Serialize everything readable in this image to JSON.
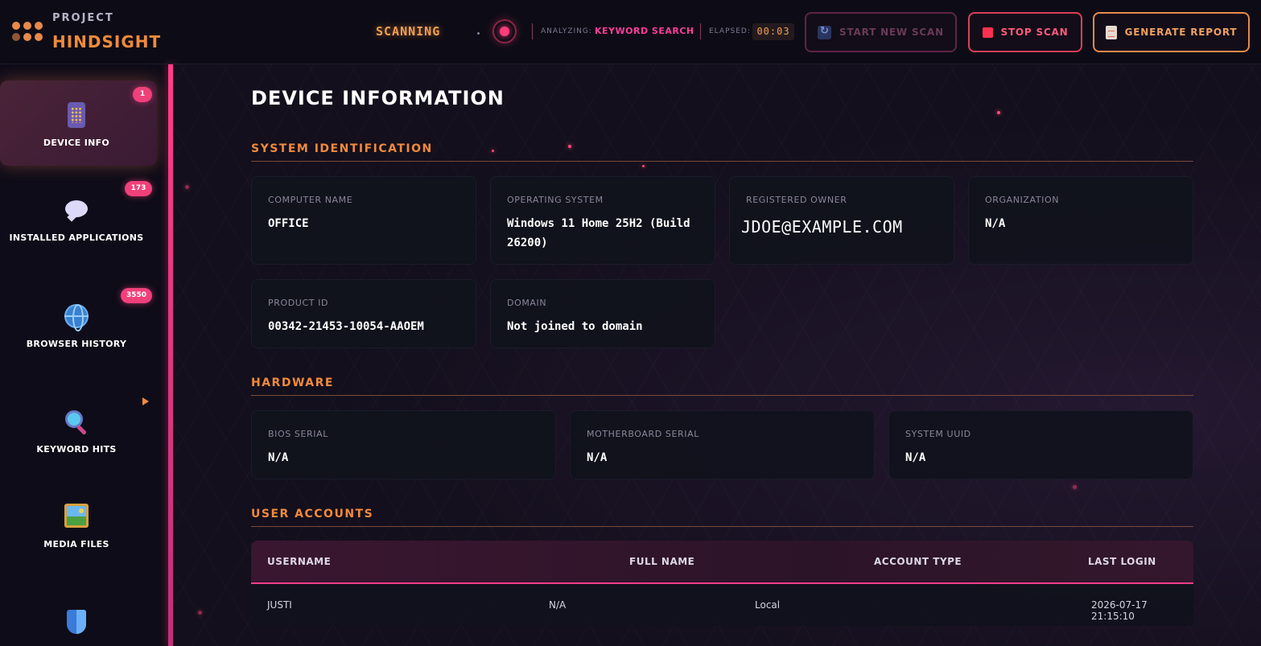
{
  "app": {
    "brand_top": "PROJECT",
    "brand_main": "HINDSIGHT"
  },
  "header": {
    "status": "SCANNING",
    "analyzing_label": "ANALYZING:",
    "analyzing_value": "KEYWORD SEARCH",
    "elapsed_label": "ELAPSED:",
    "elapsed_value": "00:03",
    "buttons": {
      "new_scan": "START NEW SCAN",
      "stop_scan": "STOP SCAN",
      "report": "GENERATE REPORT"
    }
  },
  "sidebar": {
    "items": [
      {
        "label": "DEVICE INFO",
        "badge": "1",
        "icon": "phone-icon",
        "active": true
      },
      {
        "label": "INSTALLED APPLICATIONS",
        "badge": "173",
        "icon": "speech-bubble-icon"
      },
      {
        "label": "BROWSER HISTORY",
        "badge": "3550",
        "icon": "globe-icon"
      },
      {
        "label": "KEYWORD HITS",
        "badge": "",
        "icon": "magnifier-icon"
      },
      {
        "label": "MEDIA FILES",
        "badge": "",
        "icon": "picture-icon"
      },
      {
        "label": "",
        "badge": "",
        "icon": "shield-icon"
      }
    ]
  },
  "main": {
    "title": "DEVICE INFORMATION",
    "system_identification": {
      "title": "SYSTEM IDENTIFICATION",
      "fields": [
        {
          "label": "COMPUTER NAME",
          "value": "OFFICE"
        },
        {
          "label": "OPERATING SYSTEM",
          "value": "Windows 11 Home 25H2 (Build 26200)"
        },
        {
          "label": "REGISTERED OWNER",
          "value": "JDOE@EXAMPLE.COM"
        },
        {
          "label": "ORGANIZATION",
          "value": "N/A"
        },
        {
          "label": "PRODUCT ID",
          "value": "00342-21453-10054-AAOEM"
        },
        {
          "label": "DOMAIN",
          "value": "Not joined to domain"
        }
      ]
    },
    "hardware": {
      "title": "HARDWARE",
      "fields": [
        {
          "label": "BIOS SERIAL",
          "value": "N/A"
        },
        {
          "label": "MOTHERBOARD SERIAL",
          "value": "N/A"
        },
        {
          "label": "SYSTEM UUID",
          "value": "N/A"
        }
      ]
    },
    "user_accounts": {
      "title": "USER ACCOUNTS",
      "columns": [
        "USERNAME",
        "FULL NAME",
        "ACCOUNT TYPE",
        "LAST LOGIN"
      ],
      "rows": [
        [
          "JUSTI",
          "N/A",
          "Local",
          "2026-07-17 21:15:10"
        ]
      ]
    }
  },
  "colors": {
    "accent_orange": "#f08a3c",
    "accent_pink": "#ff3d8a",
    "background": "#120f1d"
  }
}
